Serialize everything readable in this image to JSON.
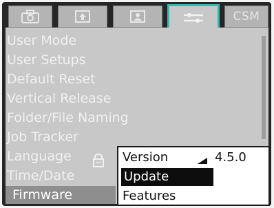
{
  "tabs": [
    {
      "icon": "camera-icon"
    },
    {
      "icon": "upload-icon"
    },
    {
      "icon": "user-icon"
    },
    {
      "icon": "wrench-settings-icon",
      "active": true
    },
    {
      "label": "CSM"
    }
  ],
  "menu": {
    "items": [
      "User Mode",
      "User Setups",
      "Default Reset",
      "Vertical Release",
      "Folder/File Naming",
      "Job Tracker",
      "Language",
      "Time/Date",
      "Firmware"
    ],
    "selected": "Firmware"
  },
  "submenu": {
    "version_label": "Version",
    "version_value": "4.5.0",
    "update_label": "Update",
    "features_label": "Features"
  },
  "colors": {
    "accent": "#37b7b0",
    "panel": "#c8c8c8",
    "frame": "#262626"
  }
}
